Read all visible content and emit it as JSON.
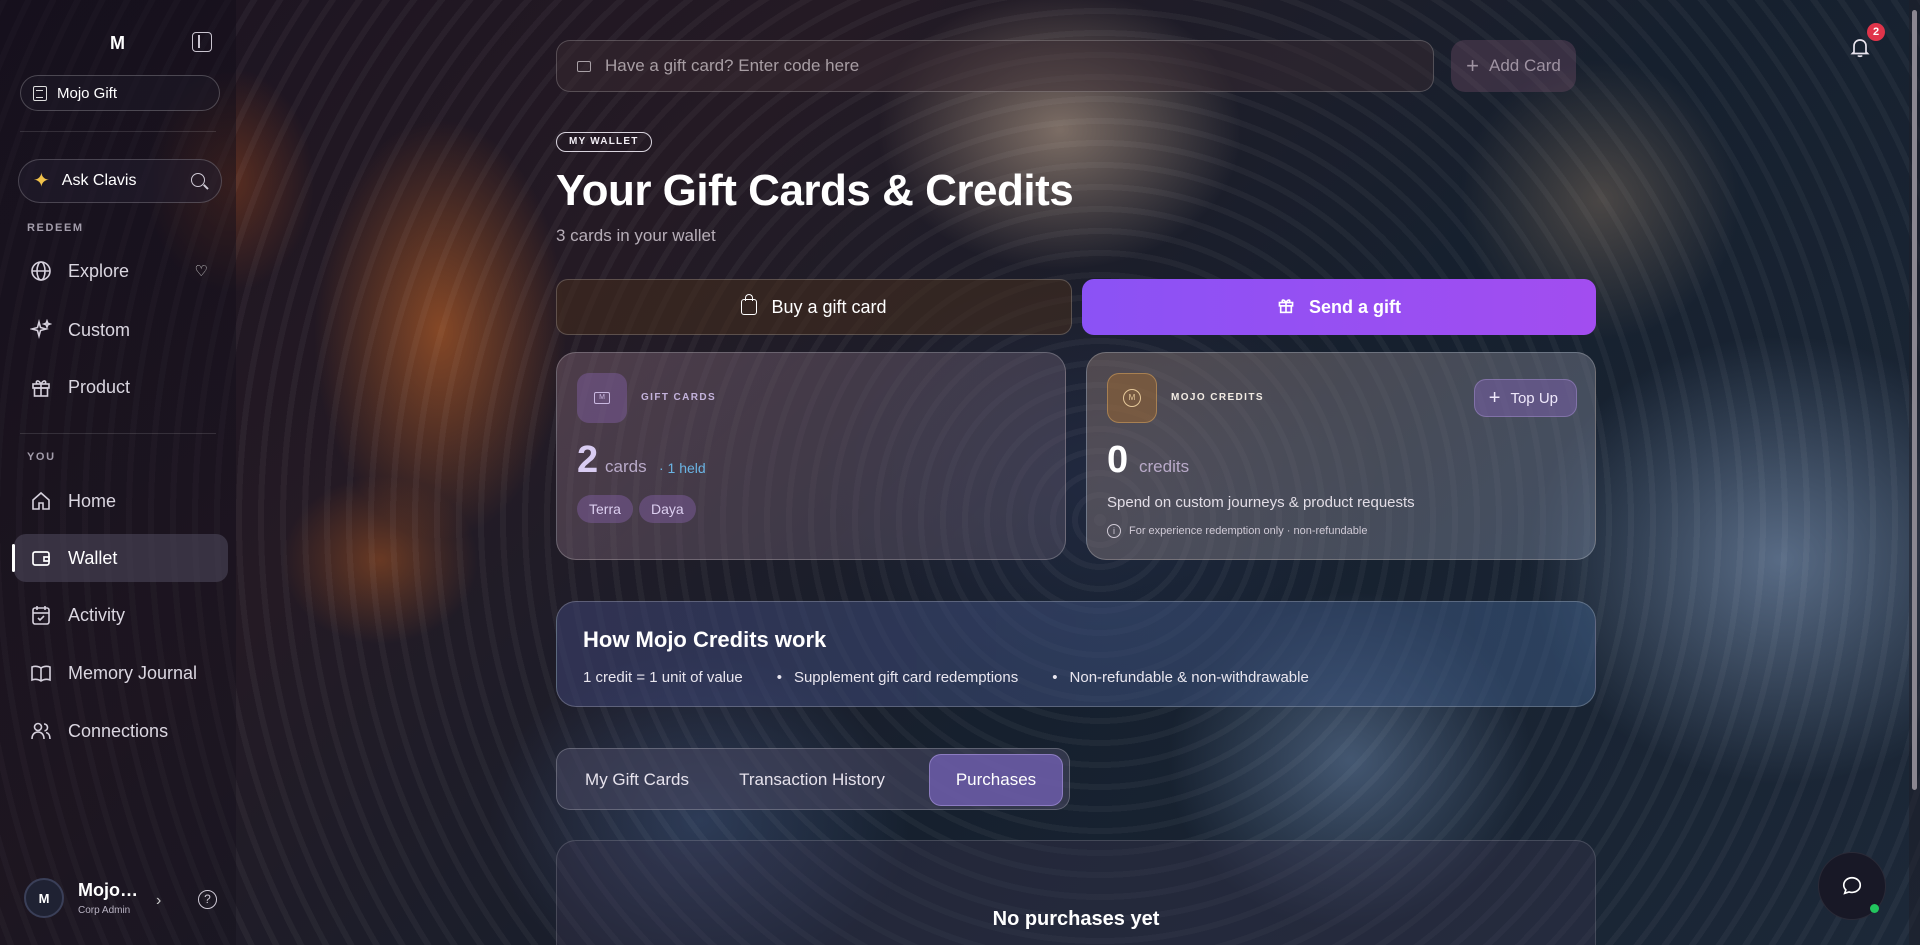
{
  "sidebar": {
    "logo": "M",
    "org_name": "Mojo Gift",
    "ask_label": "Ask Clavis",
    "section_redeem": "REDEEM",
    "section_you": "YOU",
    "redeem_items": [
      {
        "label": "Explore",
        "icon": "globe-icon"
      },
      {
        "label": "Custom",
        "icon": "sparkles-icon"
      },
      {
        "label": "Product",
        "icon": "gift-icon"
      }
    ],
    "you_items": [
      {
        "label": "Home",
        "icon": "home-icon"
      },
      {
        "label": "Wallet",
        "icon": "wallet-icon",
        "active": true
      },
      {
        "label": "Activity",
        "icon": "calendar-icon"
      },
      {
        "label": "Memory Journal",
        "icon": "book-icon"
      },
      {
        "label": "Connections",
        "icon": "users-icon"
      }
    ],
    "user": {
      "initial": "M",
      "name": "Mojo…",
      "role": "Corp Admin"
    }
  },
  "topbar": {
    "redeem_placeholder": "Have a gift card? Enter code here",
    "add_card_label": "Add Card",
    "notification_count": "2"
  },
  "header": {
    "eyebrow": "MY WALLET",
    "title": "Your Gift Cards & Credits",
    "subtitle": "3 cards in your wallet"
  },
  "actions": {
    "buy_label": "Buy a gift card",
    "send_label": "Send a gift"
  },
  "gift_card_summary": {
    "label": "GIFT CARDS",
    "count": "2",
    "unit": "cards",
    "held": "· 1 held",
    "tags": [
      "Terra",
      "Daya"
    ]
  },
  "credits_summary": {
    "label": "MOJO CREDITS",
    "topup_label": "Top Up",
    "count": "0",
    "unit": "credits",
    "description": "Spend on custom journeys & product requests",
    "note": "For experience redemption only · non-refundable"
  },
  "how_it_works": {
    "title": "How Mojo Credits work",
    "points": [
      "1 credit = 1 unit of value",
      "Supplement gift card redemptions",
      "Non-refundable & non-withdrawable"
    ]
  },
  "tabs": [
    {
      "label": "My Gift Cards"
    },
    {
      "label": "Transaction History"
    },
    {
      "label": "Purchases",
      "active": true
    }
  ],
  "empty_state": {
    "title": "No purchases yet"
  },
  "colors": {
    "accent_purple": "#8b52f5",
    "badge_red": "#e0344a",
    "online_green": "#22c55e",
    "held_blue": "#6ab4e4"
  }
}
